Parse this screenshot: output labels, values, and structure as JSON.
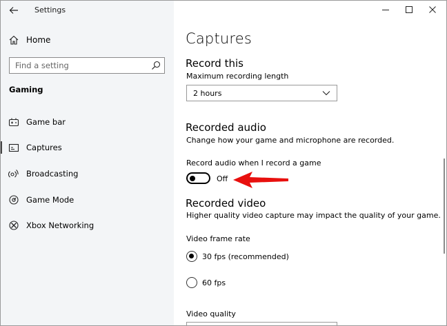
{
  "window": {
    "title": "Settings"
  },
  "sidebar": {
    "home_label": "Home",
    "search_placeholder": "Find a setting",
    "section_label": "Gaming",
    "items": [
      {
        "label": "Game bar",
        "icon": "game-bar-icon",
        "selected": false
      },
      {
        "label": "Captures",
        "icon": "captures-icon",
        "selected": true
      },
      {
        "label": "Broadcasting",
        "icon": "broadcasting-icon",
        "selected": false
      },
      {
        "label": "Game Mode",
        "icon": "game-mode-icon",
        "selected": false
      },
      {
        "label": "Xbox Networking",
        "icon": "xbox-icon",
        "selected": false
      }
    ]
  },
  "main": {
    "page_title": "Captures",
    "record_this": {
      "heading": "Record this",
      "max_length_label": "Maximum recording length",
      "max_length_value": "2 hours"
    },
    "recorded_audio": {
      "heading": "Recorded audio",
      "description": "Change how your game and microphone are recorded.",
      "toggle_label": "Record audio when I record a game",
      "toggle_state": "Off"
    },
    "recorded_video": {
      "heading": "Recorded video",
      "description": "Higher quality video capture may impact the quality of your game.",
      "frame_rate_label": "Video frame rate",
      "options": [
        {
          "label": "30 fps (recommended)",
          "selected": true
        },
        {
          "label": "60 fps",
          "selected": false
        }
      ],
      "quality_label": "Video quality"
    }
  },
  "colors": {
    "sidebar_bg": "#f3f5f7",
    "annotation_arrow": "#e8100e"
  }
}
